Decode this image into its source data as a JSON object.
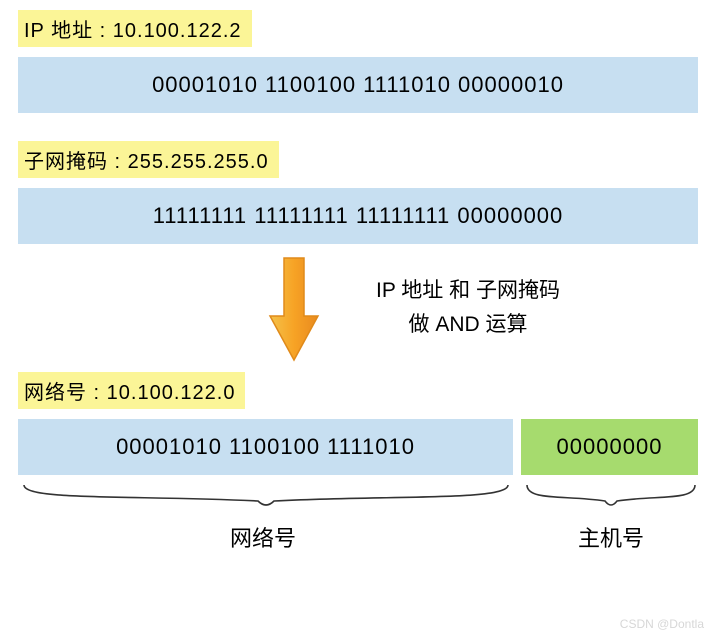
{
  "ip": {
    "label": "IP 地址 : 10.100.122.2",
    "binary": "00001010 1100100 1111010 00000010"
  },
  "mask": {
    "label": "子网掩码 : 255.255.255.0",
    "binary": "11111111 11111111 11111111 00000000"
  },
  "operation": {
    "line1": "IP 地址 和 子网掩码",
    "line2": "做 AND 运算"
  },
  "result": {
    "label": "网络号 : 10.100.122.0",
    "net_binary": "00001010 1100100 1111010",
    "host_binary": "00000000"
  },
  "bottom": {
    "net_label": "网络号",
    "host_label": "主机号"
  },
  "watermark": "CSDN @Dontla"
}
